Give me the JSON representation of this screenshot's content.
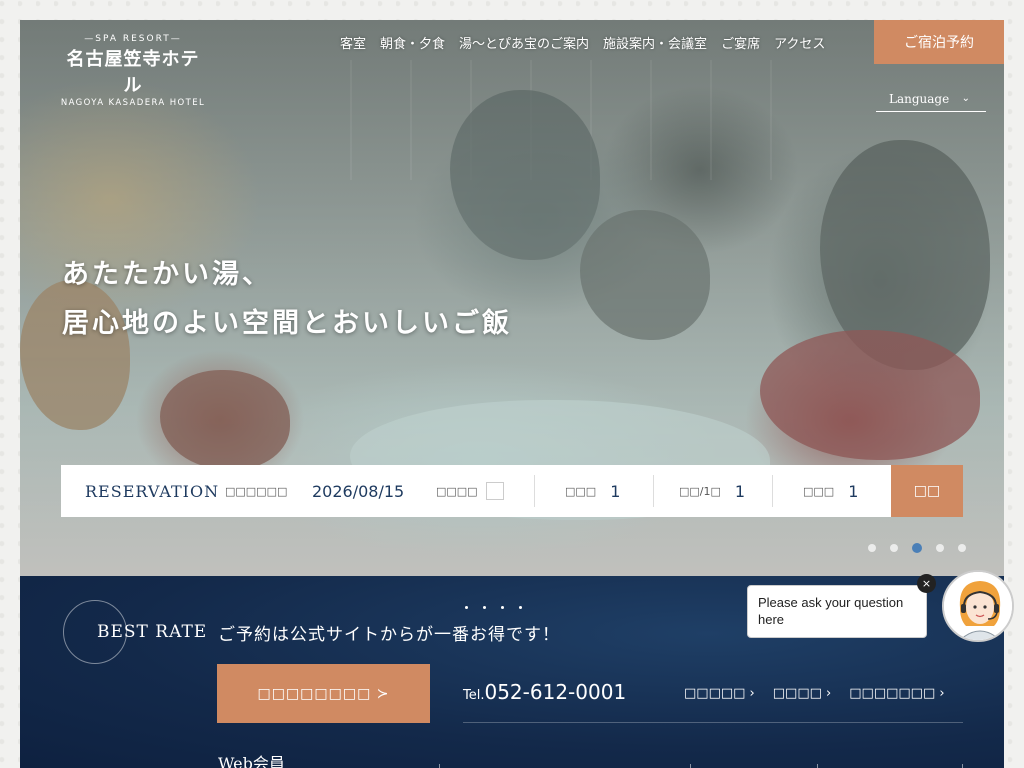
{
  "logo": {
    "spa": "—SPA RESORT—",
    "jp": "名古屋笠寺ホテル",
    "en": "NAGOYA KASADERA HOTEL"
  },
  "nav": {
    "items": [
      "客室",
      "朝食・夕食",
      "湯〜とぴあ宝のご案内",
      "施設案内・会議室",
      "ご宴席",
      "アクセス"
    ],
    "reserve": "ご宿泊予約",
    "language": "Language"
  },
  "hero": {
    "line1": "あたたかい湯、",
    "line2": "居心地のよい空間とおいしいご飯"
  },
  "booking": {
    "title": "RESERVATION",
    "date_label": "□□□□□□",
    "date_value": "2026/08/15",
    "undecided_label": "□□□□",
    "nights_label": "□□□",
    "nights_value": "1",
    "rooms_label": "□□/1□",
    "rooms_value": "1",
    "guests_label": "□□□",
    "guests_value": "1",
    "search": "□□"
  },
  "slider": {
    "count": 5,
    "active": 3
  },
  "band": {
    "best_rate": "BEST RATE",
    "message": "ご予約は公式サイトからが一番お得です！",
    "book_button": "□□□□□□□□ ≻",
    "tel_prefix": "Tel.",
    "tel": "052-612-0001",
    "links": [
      "□□□□□",
      "□□□□",
      "□□□□□□□"
    ],
    "web_member": "Web会員"
  },
  "chat": {
    "text": "Please ask your question here",
    "close": "×"
  },
  "colors": {
    "accent": "#d08a62",
    "navy": "#13294a",
    "dot_active": "#4a7fb7"
  }
}
